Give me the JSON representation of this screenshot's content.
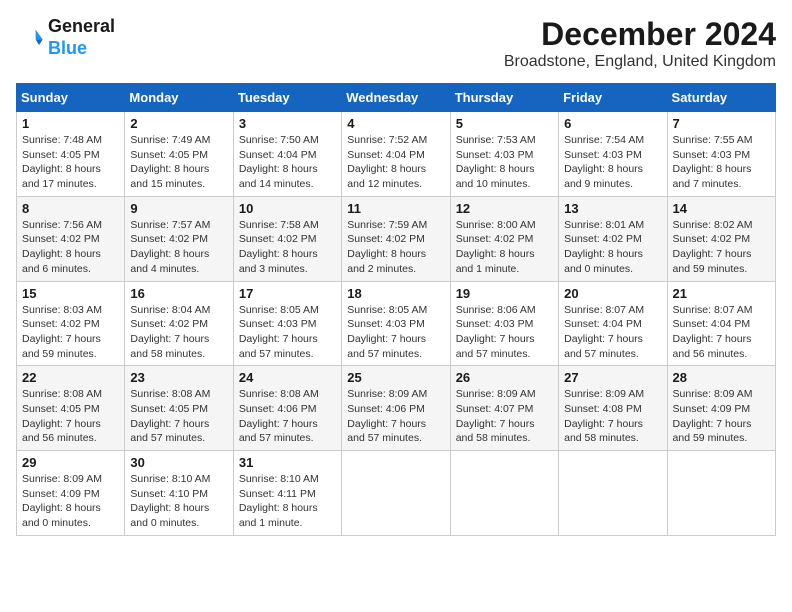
{
  "header": {
    "logo_line1": "General",
    "logo_line2": "Blue",
    "month_title": "December 2024",
    "subtitle": "Broadstone, England, United Kingdom"
  },
  "days_of_week": [
    "Sunday",
    "Monday",
    "Tuesday",
    "Wednesday",
    "Thursday",
    "Friday",
    "Saturday"
  ],
  "weeks": [
    [
      {
        "day": "1",
        "sunrise": "7:48 AM",
        "sunset": "4:05 PM",
        "daylight": "8 hours and 17 minutes."
      },
      {
        "day": "2",
        "sunrise": "7:49 AM",
        "sunset": "4:05 PM",
        "daylight": "8 hours and 15 minutes."
      },
      {
        "day": "3",
        "sunrise": "7:50 AM",
        "sunset": "4:04 PM",
        "daylight": "8 hours and 14 minutes."
      },
      {
        "day": "4",
        "sunrise": "7:52 AM",
        "sunset": "4:04 PM",
        "daylight": "8 hours and 12 minutes."
      },
      {
        "day": "5",
        "sunrise": "7:53 AM",
        "sunset": "4:03 PM",
        "daylight": "8 hours and 10 minutes."
      },
      {
        "day": "6",
        "sunrise": "7:54 AM",
        "sunset": "4:03 PM",
        "daylight": "8 hours and 9 minutes."
      },
      {
        "day": "7",
        "sunrise": "7:55 AM",
        "sunset": "4:03 PM",
        "daylight": "8 hours and 7 minutes."
      }
    ],
    [
      {
        "day": "8",
        "sunrise": "7:56 AM",
        "sunset": "4:02 PM",
        "daylight": "8 hours and 6 minutes."
      },
      {
        "day": "9",
        "sunrise": "7:57 AM",
        "sunset": "4:02 PM",
        "daylight": "8 hours and 4 minutes."
      },
      {
        "day": "10",
        "sunrise": "7:58 AM",
        "sunset": "4:02 PM",
        "daylight": "8 hours and 3 minutes."
      },
      {
        "day": "11",
        "sunrise": "7:59 AM",
        "sunset": "4:02 PM",
        "daylight": "8 hours and 2 minutes."
      },
      {
        "day": "12",
        "sunrise": "8:00 AM",
        "sunset": "4:02 PM",
        "daylight": "8 hours and 1 minute."
      },
      {
        "day": "13",
        "sunrise": "8:01 AM",
        "sunset": "4:02 PM",
        "daylight": "8 hours and 0 minutes."
      },
      {
        "day": "14",
        "sunrise": "8:02 AM",
        "sunset": "4:02 PM",
        "daylight": "7 hours and 59 minutes."
      }
    ],
    [
      {
        "day": "15",
        "sunrise": "8:03 AM",
        "sunset": "4:02 PM",
        "daylight": "7 hours and 59 minutes."
      },
      {
        "day": "16",
        "sunrise": "8:04 AM",
        "sunset": "4:02 PM",
        "daylight": "7 hours and 58 minutes."
      },
      {
        "day": "17",
        "sunrise": "8:05 AM",
        "sunset": "4:03 PM",
        "daylight": "7 hours and 57 minutes."
      },
      {
        "day": "18",
        "sunrise": "8:05 AM",
        "sunset": "4:03 PM",
        "daylight": "7 hours and 57 minutes."
      },
      {
        "day": "19",
        "sunrise": "8:06 AM",
        "sunset": "4:03 PM",
        "daylight": "7 hours and 57 minutes."
      },
      {
        "day": "20",
        "sunrise": "8:07 AM",
        "sunset": "4:04 PM",
        "daylight": "7 hours and 57 minutes."
      },
      {
        "day": "21",
        "sunrise": "8:07 AM",
        "sunset": "4:04 PM",
        "daylight": "7 hours and 56 minutes."
      }
    ],
    [
      {
        "day": "22",
        "sunrise": "8:08 AM",
        "sunset": "4:05 PM",
        "daylight": "7 hours and 56 minutes."
      },
      {
        "day": "23",
        "sunrise": "8:08 AM",
        "sunset": "4:05 PM",
        "daylight": "7 hours and 57 minutes."
      },
      {
        "day": "24",
        "sunrise": "8:08 AM",
        "sunset": "4:06 PM",
        "daylight": "7 hours and 57 minutes."
      },
      {
        "day": "25",
        "sunrise": "8:09 AM",
        "sunset": "4:06 PM",
        "daylight": "7 hours and 57 minutes."
      },
      {
        "day": "26",
        "sunrise": "8:09 AM",
        "sunset": "4:07 PM",
        "daylight": "7 hours and 58 minutes."
      },
      {
        "day": "27",
        "sunrise": "8:09 AM",
        "sunset": "4:08 PM",
        "daylight": "7 hours and 58 minutes."
      },
      {
        "day": "28",
        "sunrise": "8:09 AM",
        "sunset": "4:09 PM",
        "daylight": "7 hours and 59 minutes."
      }
    ],
    [
      {
        "day": "29",
        "sunrise": "8:09 AM",
        "sunset": "4:09 PM",
        "daylight": "8 hours and 0 minutes."
      },
      {
        "day": "30",
        "sunrise": "8:10 AM",
        "sunset": "4:10 PM",
        "daylight": "8 hours and 0 minutes."
      },
      {
        "day": "31",
        "sunrise": "8:10 AM",
        "sunset": "4:11 PM",
        "daylight": "8 hours and 1 minute."
      },
      null,
      null,
      null,
      null
    ]
  ]
}
